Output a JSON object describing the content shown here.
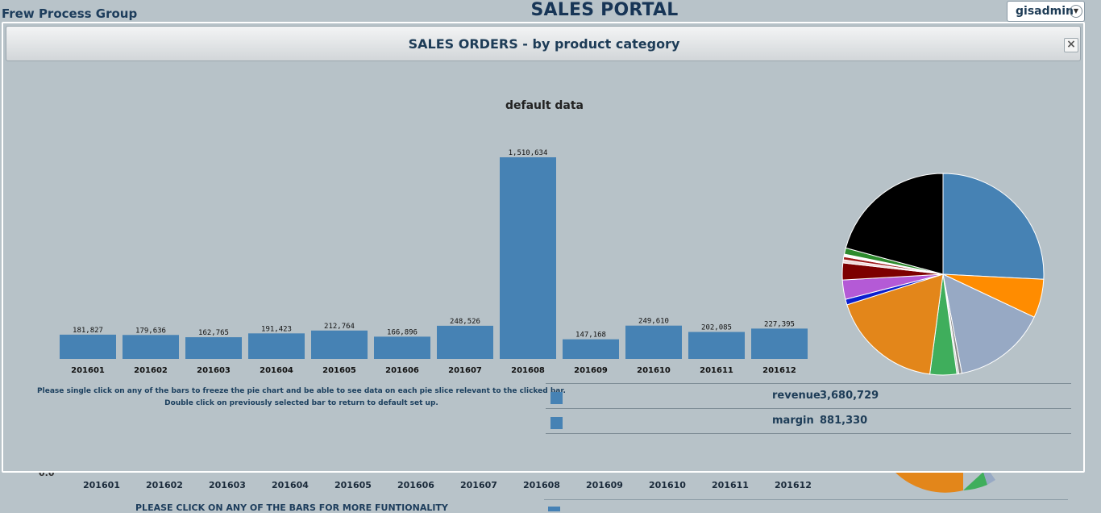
{
  "header": {
    "company": "Frew Process Group",
    "portal_title": "SALES PORTAL",
    "user": "gisadmin",
    "user_dropdown_icon": "chevron-down-icon"
  },
  "background_page": {
    "x_labels": [
      "201601",
      "201602",
      "201603",
      "201604",
      "201605",
      "201606",
      "201607",
      "201608",
      "201609",
      "201610",
      "201611",
      "201612"
    ],
    "axis_zero": "0.0",
    "message": "PLEASE CLICK ON ANY OF THE BARS FOR MORE FUNTIONALITY"
  },
  "modal": {
    "title": "SALES ORDERS - by product category",
    "close_label": "×",
    "help_line1": "Please single click on any of the bars to freeze the pie chart and be able to see data on each pie slice relevant to the clicked bar.",
    "help_line2": "Double click on previously selected bar to return to default set up.",
    "legend": [
      {
        "name": "revenue",
        "value": "3,680,729",
        "color": "#4682b4"
      },
      {
        "name": "margin",
        "value": "881,330",
        "color": "#4682b4"
      }
    ]
  },
  "chart_data": [
    {
      "type": "bar",
      "title": "default data",
      "categories": [
        "201601",
        "201602",
        "201603",
        "201604",
        "201605",
        "201606",
        "201607",
        "201608",
        "201609",
        "201610",
        "201611",
        "201612"
      ],
      "values": [
        181827,
        179636,
        162765,
        191423,
        212764,
        166896,
        248526,
        1510634,
        147168,
        249610,
        202085,
        227395
      ],
      "value_labels": [
        "181,827",
        "179,636",
        "162,765",
        "191,423",
        "212,764",
        "166,896",
        "248,526",
        "1,510,634",
        "147,168",
        "249,610",
        "202,085",
        "227,395"
      ],
      "color": "#4682b4",
      "ylim": [
        0,
        1510634
      ]
    },
    {
      "type": "pie",
      "slices": [
        {
          "value": 25.8,
          "color": "#4682b4"
        },
        {
          "value": 6.2,
          "color": "#ff8c00"
        },
        {
          "value": 15.0,
          "color": "#97a9c4"
        },
        {
          "value": 0.5,
          "color": "#8a8a8a"
        },
        {
          "value": 0.3,
          "color": "#d0d0d0"
        },
        {
          "value": 4.3,
          "color": "#3fae5c"
        },
        {
          "value": 18.0,
          "color": "#e3861a"
        },
        {
          "value": 0.9,
          "color": "#0b1fcf"
        },
        {
          "value": 3.1,
          "color": "#b45ad6"
        },
        {
          "value": 2.7,
          "color": "#7d0000"
        },
        {
          "value": 0.5,
          "color": "#f0dada"
        },
        {
          "value": 0.5,
          "color": "#9e1c1c"
        },
        {
          "value": 0.4,
          "color": "#ffffff"
        },
        {
          "value": 1.0,
          "color": "#2e8b2e"
        },
        {
          "value": 20.8,
          "color": "#000000"
        }
      ]
    }
  ]
}
